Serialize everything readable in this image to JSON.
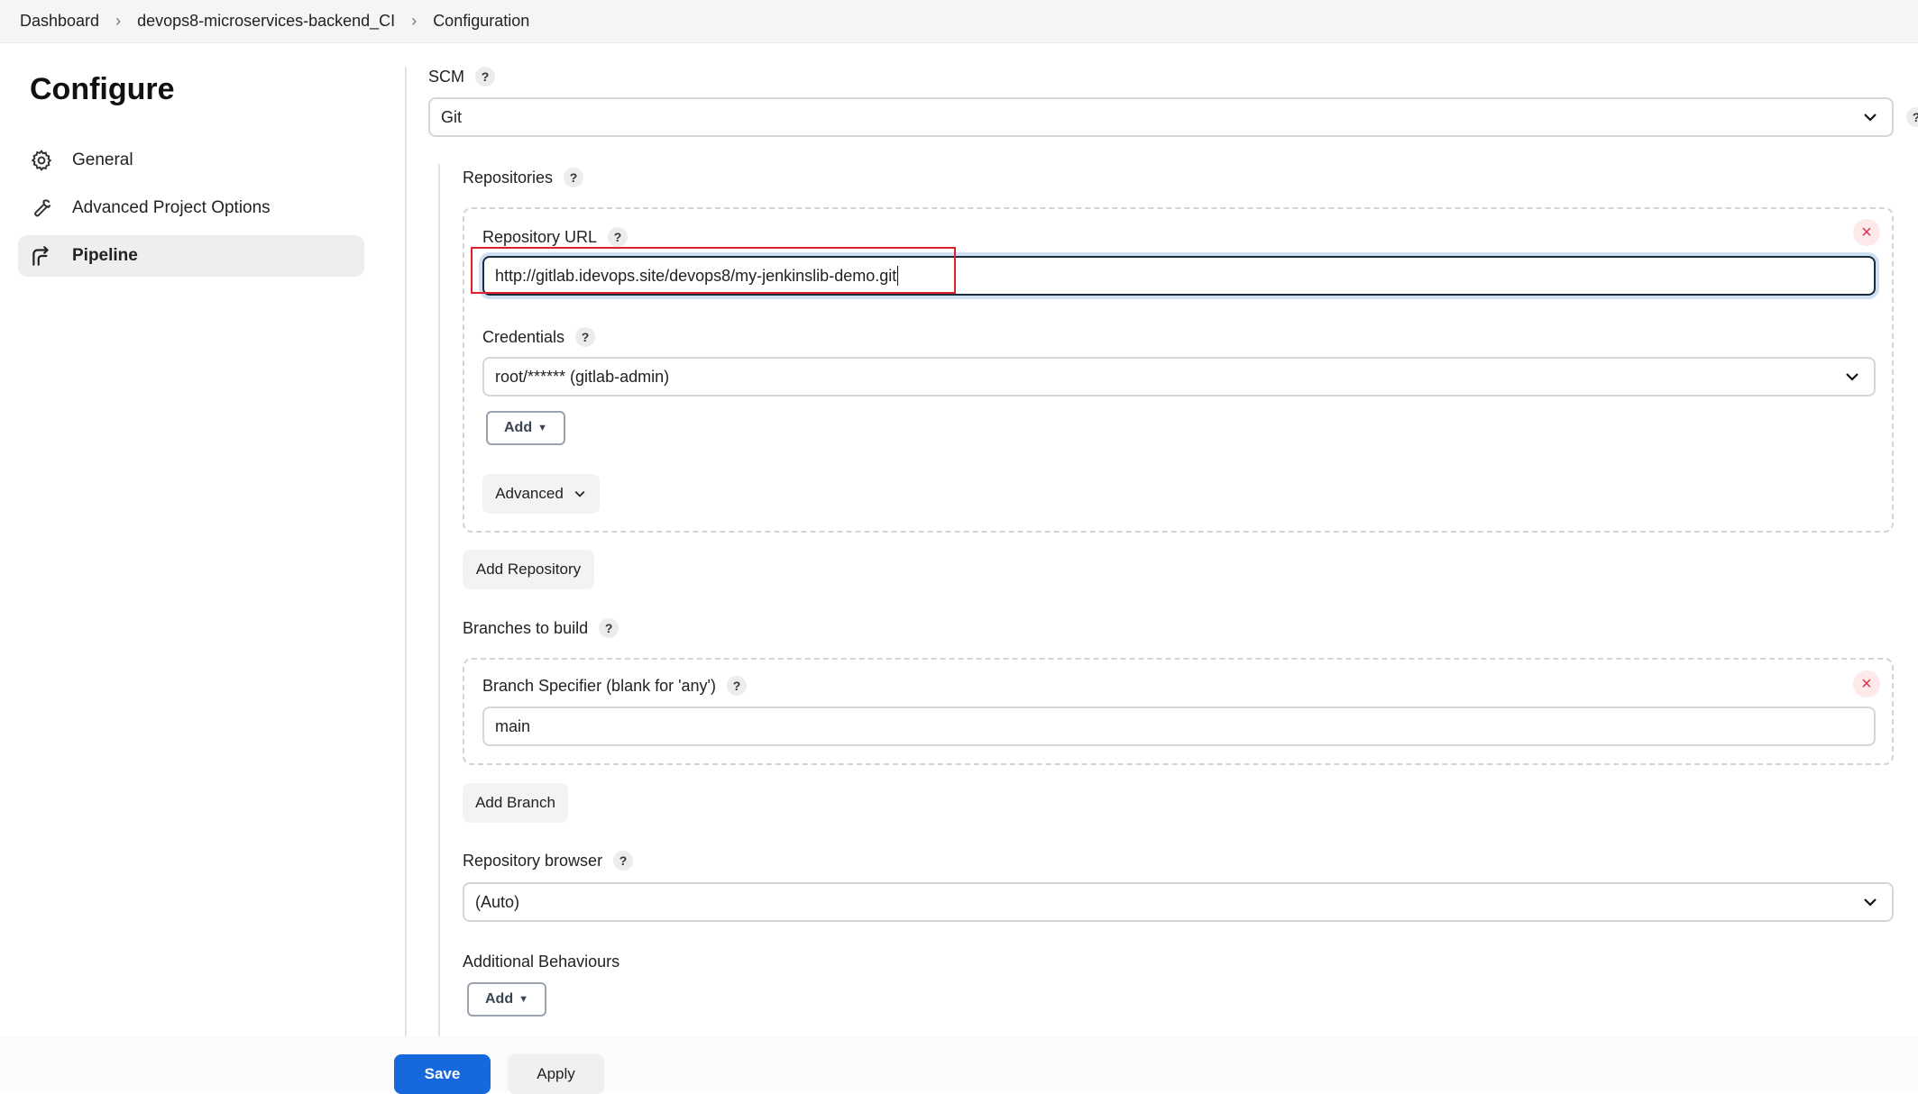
{
  "breadcrumb": [
    "Dashboard",
    "devops8-microservices-backend_CI",
    "Configuration"
  ],
  "page_title": "Configure",
  "nav": [
    {
      "label": "General",
      "icon": "gear-icon"
    },
    {
      "label": "Advanced Project Options",
      "icon": "wrench-icon"
    },
    {
      "label": "Pipeline",
      "icon": "pipeline-icon",
      "active": true
    }
  ],
  "scm": {
    "label": "SCM",
    "value": "Git"
  },
  "repositories": {
    "label": "Repositories",
    "repo_url_label": "Repository URL",
    "repo_url_value": "http://gitlab.idevops.site/devops8/my-jenkinslib-demo.git",
    "credentials_label": "Credentials",
    "credentials_value": "root/****** (gitlab-admin)",
    "add_label": "Add",
    "advanced_label": "Advanced",
    "add_repository_label": "Add Repository"
  },
  "branches": {
    "label": "Branches to build",
    "specifier_label": "Branch Specifier (blank for 'any')",
    "specifier_value": "main",
    "add_branch_label": "Add Branch"
  },
  "repo_browser": {
    "label": "Repository browser",
    "value": "(Auto)"
  },
  "additional_behaviours": {
    "label": "Additional Behaviours",
    "add_label": "Add"
  },
  "footer": {
    "save_label": "Save",
    "apply_label": "Apply"
  },
  "help_glyph": "?",
  "close_glyph": "×",
  "colors": {
    "accent": "#1668dc",
    "highlight_box": "#e0202c",
    "remove": "#d93048"
  }
}
